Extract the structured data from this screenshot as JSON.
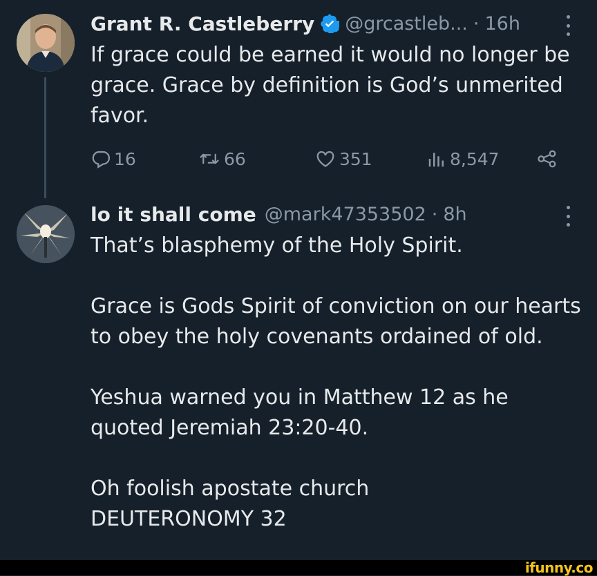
{
  "tweet1": {
    "name": "Grant R. Castleberry",
    "handle": "@grcastleb...",
    "separator": "·",
    "time": "16h",
    "text": "If grace could be earned it would no longer be grace. Grace by definition is God’s unmerited favor.",
    "actions": {
      "replies": "16",
      "retweets": "66",
      "likes": "351",
      "views": "8,547"
    }
  },
  "tweet2": {
    "name": "lo it shall come",
    "handle": "@mark47353502",
    "separator": "·",
    "time": "8h",
    "paragraphs": [
      "That’s blasphemy of the Holy Spirit.",
      "Grace is Gods Spirit of conviction on our hearts to obey the holy covenants ordained of old.",
      "Yeshua warned you in Matthew 12 as he quoted Jeremiah 23:20-40.",
      "Oh foolish apostate church",
      "DEUTERONOMY 32"
    ]
  },
  "watermark": "ifunny.co",
  "colors": {
    "background": "#15202b",
    "text": "#e7e9ea",
    "muted": "#8b98a5",
    "verified": "#1d9bf0",
    "watermark": "#f5c518"
  },
  "icons": [
    "reply-icon",
    "retweet-icon",
    "like-icon",
    "views-icon",
    "share-icon",
    "verified-badge-icon",
    "more-icon"
  ]
}
